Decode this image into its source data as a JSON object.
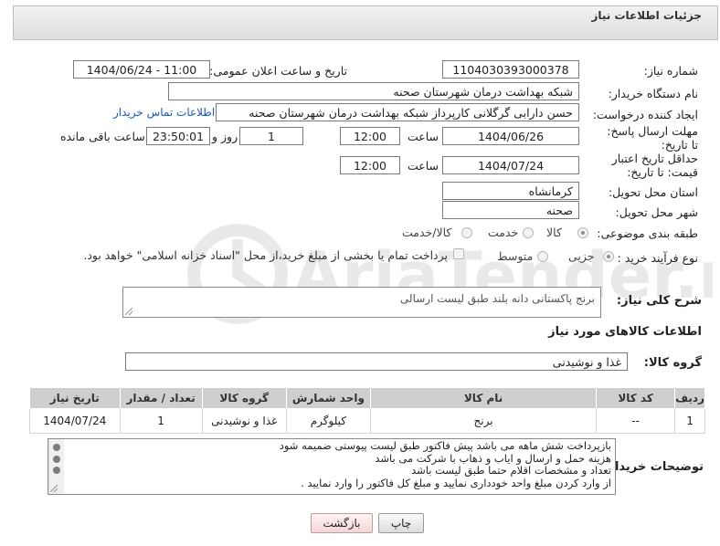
{
  "header": {
    "title": "جزئیات اطلاعات نیاز"
  },
  "form": {
    "need_number": {
      "label": "شماره نیاز:",
      "value": "1104030393000378"
    },
    "announce_datetime": {
      "label": "تاریخ و ساعت اعلان عمومی:",
      "value": "1404/06/24 - 11:00"
    },
    "buyer_org": {
      "label": "نام دستگاه خریدار:",
      "value": "شبکه بهداشت درمان شهرستان صحنه"
    },
    "requester": {
      "label": "ایجاد کننده درخواست:",
      "value": "حسن دارابی گرگلانی کارپرداز شبکه بهداشت درمان شهرستان صحنه",
      "contact_link": "اطلاعات تماس خریدار"
    },
    "reply_deadline": {
      "label": "مهلت ارسال پاسخ: تا تاریخ:",
      "date": "1404/06/26",
      "time_label": "ساعت",
      "time": "12:00",
      "days": "1",
      "days_label": "روز و",
      "remaining": "23:50:01",
      "remaining_label": "ساعت باقی مانده"
    },
    "price_validity": {
      "label": "حداقل تاریخ اعتبار قیمت: تا تاریخ:",
      "date": "1404/07/24",
      "time_label": "ساعت",
      "time": "12:00"
    },
    "province": {
      "label": "استان محل تحویل:",
      "value": "کرمانشاه"
    },
    "city": {
      "label": "شهر محل تحویل:",
      "value": "صحنه"
    },
    "category": {
      "label": "طبقه بندی موضوعی:",
      "options": [
        "کالا",
        "خدمت",
        "کالا/خدمت"
      ],
      "selected": "کالا"
    },
    "process": {
      "label": "نوع فرآیند خرید :",
      "options": [
        "جزیی",
        "متوسط"
      ],
      "selected": "جزیی",
      "payment_note": "پرداخت تمام یا بخشی از مبلغ خرید،از محل \"اسناد خزانه اسلامی\" خواهد بود."
    }
  },
  "summary": {
    "label": "شرح کلی نیاز:",
    "value": "برنج پاکستانی دانه بلند طبق لیست ارسالی"
  },
  "goods": {
    "section_title": "اطلاعات کالاهای مورد نیاز",
    "group_label": "گروه کالا:",
    "group_value": "غذا و نوشیدنی",
    "columns": [
      "ردیف",
      "کد کالا",
      "نام کالا",
      "واحد شمارش",
      "گروه کالا",
      "تعداد / مقدار",
      "تاریخ نیاز"
    ],
    "rows": [
      {
        "row": "1",
        "code": "--",
        "name": "برنج",
        "unit": "کیلوگرم",
        "group": "غذا و نوشیدنی",
        "qty": "1",
        "date": "1404/07/24"
      }
    ]
  },
  "buyer_notes": {
    "label": "توضیحات خریدار:",
    "lines": [
      "بازپرداخت شش ماهه می باشد پیش فاکتور طبق لیست پیوستی ضمیمه شود",
      "هزینه حمل و ارسال و ایاب و ذهاب با شرکت می باشد",
      "تعداد و مشخصات اقلام حتما طبق لیست باشد",
      "از وارد کردن مبلغ واحد خودداری نمایید و مبلغ کل فاکتور را وارد نمایید ."
    ]
  },
  "buttons": {
    "print": "چاپ",
    "back": "بازگشت"
  },
  "watermark": {
    "text": "AriaTender.net"
  },
  "colors": {
    "header_bg": "#e3e3e3",
    "link": "#1a56c4",
    "table_header": "#cfcfcf",
    "back_button": "#f3d6d6"
  }
}
